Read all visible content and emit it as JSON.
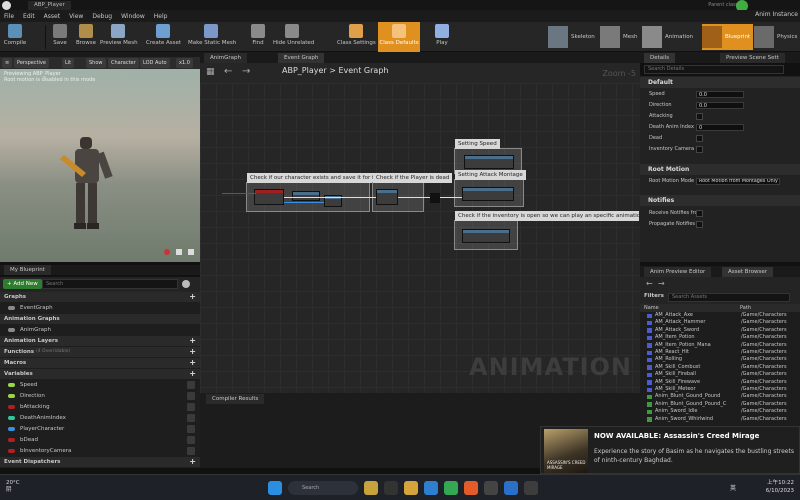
{
  "window": {
    "tab_title": "ABP_Player",
    "parent_class_label": "Parent class:",
    "parent_class_value": "Anim Instance"
  },
  "menu": [
    "File",
    "Edit",
    "Asset",
    "View",
    "Debug",
    "Window",
    "Help"
  ],
  "toolbar": [
    {
      "label": "Compile",
      "icon": "compile-icon",
      "color": "#5a8fb8"
    },
    {
      "label": "Save",
      "icon": "save-icon",
      "color": "#7a7a7a"
    },
    {
      "label": "Browse",
      "icon": "browse-icon",
      "color": "#b08e4a"
    },
    {
      "label": "Preview Mesh",
      "icon": "preview-mesh-icon",
      "color": "#8aa6c4"
    },
    {
      "label": "Create Asset",
      "icon": "create-asset-icon",
      "color": "#6e9fd0"
    },
    {
      "label": "Make Static Mesh",
      "icon": "static-mesh-icon",
      "color": "#7c98c8"
    },
    {
      "label": "Find",
      "icon": "find-icon",
      "color": "#8a8a8a"
    },
    {
      "label": "Hide Unrelated",
      "icon": "hide-unrelated-icon",
      "color": "#8a8a8a"
    },
    {
      "label": "Class Settings",
      "icon": "class-settings-icon",
      "color": "#e0a04a"
    },
    {
      "label": "Class Defaults",
      "icon": "class-defaults-icon",
      "color": "#e0a04a"
    },
    {
      "label": "Play",
      "icon": "play-icon",
      "color": "#8fb0e0"
    }
  ],
  "modes": [
    "Skeleton",
    "Mesh",
    "Animation",
    "Blueprint",
    "Physics"
  ],
  "viewport": {
    "tabs": [
      "Viewport"
    ],
    "buttons": [
      "Perspective",
      "Lit",
      "Show",
      "Character",
      "LOD Auto",
      "x1.0"
    ],
    "hud_line1": "Previewing ABP_Player",
    "hud_line2": "Root motion is disabled in this mode"
  },
  "blueprint": {
    "tab": "My Blueprint",
    "add_new": "+ Add New",
    "search_placeholder": "Search",
    "rows": [
      {
        "label": "Graphs",
        "type": "section",
        "plus": true
      },
      {
        "label": "EventGraph",
        "type": "item",
        "color": "#8a8a8a"
      },
      {
        "label": "Animation Graphs",
        "type": "section",
        "plus": false
      },
      {
        "label": "AnimGraph",
        "type": "item",
        "color": "#8a8a8a"
      },
      {
        "label": "Animation Layers",
        "type": "section",
        "plus": true
      },
      {
        "label": "Functions",
        "type": "section",
        "plus": true,
        "note": "(4 Overridable)"
      },
      {
        "label": "Macros",
        "type": "section",
        "plus": true
      },
      {
        "label": "Variables",
        "type": "section",
        "plus": true
      },
      {
        "label": "Speed",
        "type": "var",
        "color": "#9ad64a"
      },
      {
        "label": "Direction",
        "type": "var",
        "color": "#9ad64a"
      },
      {
        "label": "bAttacking",
        "type": "var",
        "color": "#b02020"
      },
      {
        "label": "DeathAnimIndex",
        "type": "var",
        "color": "#2fc89a"
      },
      {
        "label": "PlayerCharacter",
        "type": "var",
        "color": "#3a8fe0"
      },
      {
        "label": "bDead",
        "type": "var",
        "color": "#b02020"
      },
      {
        "label": "bInventoryCamera",
        "type": "var",
        "color": "#b02020"
      },
      {
        "label": "Event Dispatchers",
        "type": "section",
        "plus": true
      }
    ]
  },
  "graph": {
    "tabs": [
      "AnimGraph",
      "Event Graph"
    ],
    "breadcrumb": "ABP_Player  >  Event Graph",
    "zoom": "Zoom -5",
    "watermark": "ANIMATION",
    "comments": [
      "Check if our character exists and save it for future use",
      "Check if the Player is dead",
      "Setting Speed",
      "Setting Attack Montage",
      "Check if the inventory is open so we can play an specific animation"
    ],
    "compiler_tab": "Compiler Results"
  },
  "details": {
    "tabs": [
      "Details",
      "Preview Scene Sett"
    ],
    "search_placeholder": "Search Details",
    "default_section": "Default",
    "fields": [
      {
        "label": "Speed",
        "kind": "number",
        "value": "0.0"
      },
      {
        "label": "Direction",
        "kind": "number",
        "value": "0.0"
      },
      {
        "label": "Attacking",
        "kind": "checkbox"
      },
      {
        "label": "Death Anim Index",
        "kind": "number",
        "value": "0"
      },
      {
        "label": "Dead",
        "kind": "checkbox"
      },
      {
        "label": "Inventory Camera",
        "kind": "checkbox"
      }
    ],
    "root_motion_section": "Root Motion",
    "root_motion_label": "Root Motion Mode",
    "root_motion_value": "Root Motion from Montages Only",
    "notifies_section": "Notifies",
    "notifies": [
      "Receive Notifies fror",
      "Propagate Notifies t"
    ]
  },
  "asset_browser": {
    "tabs": [
      "Anim Preview Editor",
      "Asset Browser"
    ],
    "filters_label": "Filters",
    "search_placeholder": "Search Assets",
    "col_name": "Name",
    "col_path": "Path",
    "rows": [
      {
        "name": "AM_Attack_Axe",
        "path": "/Game/Characters",
        "color": "#4a5bd6"
      },
      {
        "name": "AM_Attack_Hammer",
        "path": "/Game/Characters",
        "color": "#4a5bd6"
      },
      {
        "name": "AM_Attack_Sword",
        "path": "/Game/Characters",
        "color": "#4a5bd6"
      },
      {
        "name": "AM_Item_Potion",
        "path": "/Game/Characters",
        "color": "#4a5bd6"
      },
      {
        "name": "AM_Item_Potion_Mana",
        "path": "/Game/Characters",
        "color": "#4a5bd6"
      },
      {
        "name": "AM_React_Hit",
        "path": "/Game/Characters",
        "color": "#4a5bd6"
      },
      {
        "name": "AM_Rolling",
        "path": "/Game/Characters",
        "color": "#4a5bd6"
      },
      {
        "name": "AM_Skill_Combust",
        "path": "/Game/Characters",
        "color": "#4a5bd6"
      },
      {
        "name": "AM_Skill_Fireball",
        "path": "/Game/Characters",
        "color": "#4a5bd6"
      },
      {
        "name": "AM_Skill_Firewave",
        "path": "/Game/Characters",
        "color": "#4a5bd6"
      },
      {
        "name": "AM_Skill_Meteor",
        "path": "/Game/Characters",
        "color": "#4a5bd6"
      },
      {
        "name": "Anim_Blunt_Gound_Pound",
        "path": "/Game/Characters",
        "color": "#3f9a3f"
      },
      {
        "name": "Anim_Blunt_Gound_Pound_C",
        "path": "/Game/Characters",
        "color": "#3f9a3f"
      },
      {
        "name": "Anim_Sword_Idle",
        "path": "/Game/Characters",
        "color": "#3f9a3f"
      },
      {
        "name": "Anim_Sword_Whirlwind",
        "path": "/Game/Characters",
        "color": "#3f9a3f"
      }
    ]
  },
  "toast": {
    "title": "NOW AVAILABLE: Assassin's Creed Mirage",
    "body": "Experience the story of Basim as he navigates the bustling streets of ninth-century Baghdad.",
    "image_caption": "ASSASSIN'S CREED MIRAGE"
  },
  "taskbar": {
    "temp": "20°C",
    "weather": "阴",
    "search_placeholder": "Search",
    "lang": "英",
    "time": "上午10:22",
    "date": "6/10/2023"
  }
}
